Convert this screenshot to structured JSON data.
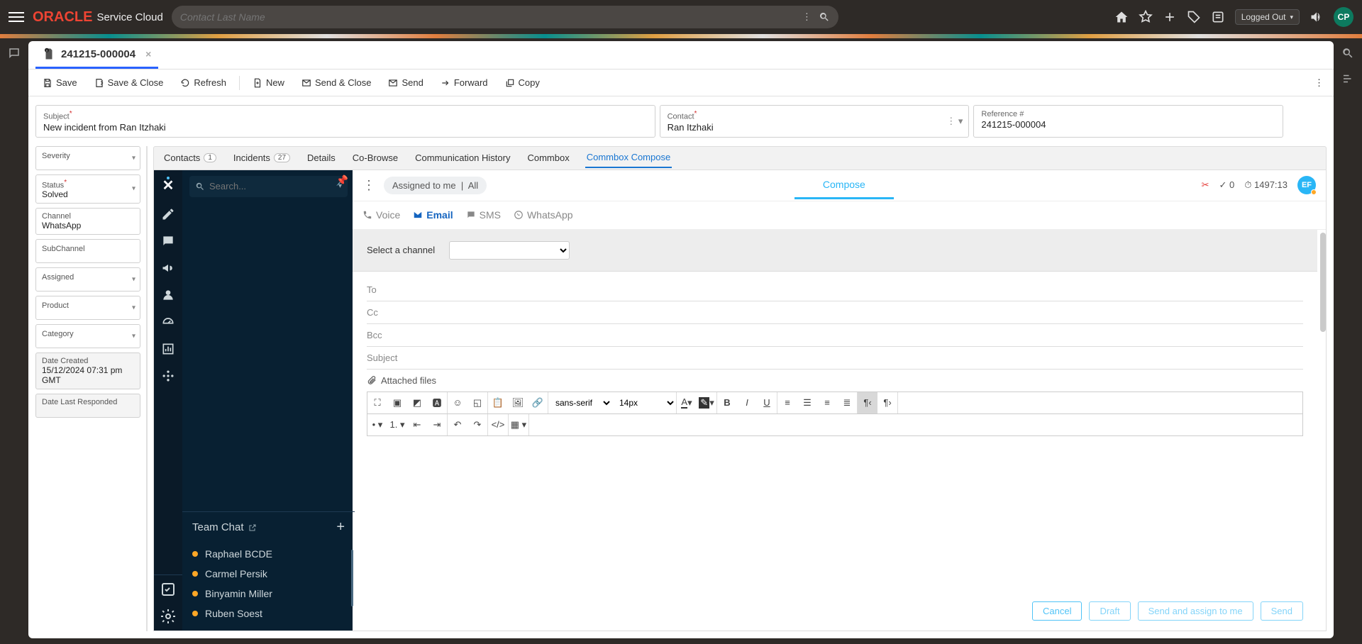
{
  "top": {
    "brand": "ORACLE",
    "product": "Service Cloud",
    "search_placeholder": "Contact Last Name",
    "status": "Logged Out",
    "avatar": "CP"
  },
  "tab": {
    "title": "241215-000004"
  },
  "toolbar": {
    "save": "Save",
    "save_close": "Save & Close",
    "refresh": "Refresh",
    "new": "New",
    "send_close": "Send & Close",
    "send": "Send",
    "forward": "Forward",
    "copy": "Copy"
  },
  "info": {
    "subject_label": "Subject",
    "subject_value": "New incident from Ran Itzhaki",
    "contact_label": "Contact",
    "contact_value": "Ran Itzhaki",
    "ref_label": "Reference #",
    "ref_value": "241215-000004"
  },
  "fields": {
    "severity": "Severity",
    "status_l": "Status",
    "status_v": "Solved",
    "channel_l": "Channel",
    "channel_v": "WhatsApp",
    "subchannel": "SubChannel",
    "assigned": "Assigned",
    "product": "Product",
    "category": "Category",
    "datec_l": "Date Created",
    "datec_v": "15/12/2024 07:31 pm GMT",
    "datel_l": "Date Last Responded"
  },
  "subtabs": {
    "contacts": "Contacts",
    "contacts_n": "1",
    "incidents": "Incidents",
    "incidents_n": "27",
    "details": "Details",
    "cobrowse": "Co-Browse",
    "comm_hist": "Communication History",
    "commbox": "Commbox",
    "commbox_compose": "Commbox Compose"
  },
  "chat": {
    "search_ph": "Search...",
    "team_chat": "Team Chat",
    "members": [
      "Raphael BCDE",
      "Carmel Persik",
      "Binyamin Miller",
      "Ruben Soest"
    ]
  },
  "compose": {
    "assigned_to_me": "Assigned to me",
    "all": "All",
    "compose_tab": "Compose",
    "count": "0",
    "timer": "1497:13",
    "avatar2": "EF",
    "ch_voice": "Voice",
    "ch_email": "Email",
    "ch_sms": "SMS",
    "ch_wa": "WhatsApp",
    "select_channel_l": "Select a channel",
    "to": "To",
    "cc": "Cc",
    "bcc": "Bcc",
    "subject": "Subject",
    "attached": "Attached files",
    "font_family": "sans-serif",
    "font_size": "14px",
    "cancel": "Cancel",
    "draft": "Draft",
    "send_assign": "Send and assign to me",
    "send": "Send"
  }
}
